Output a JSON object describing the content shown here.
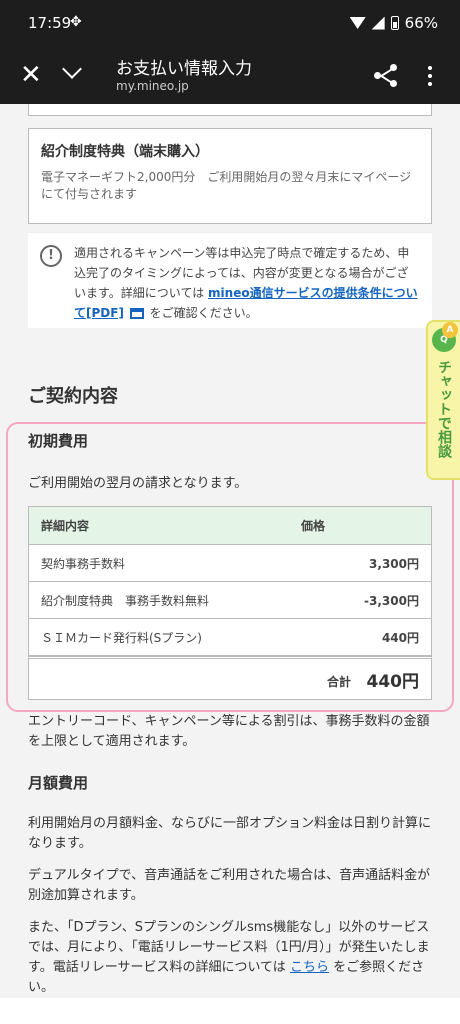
{
  "status_bar": {
    "time": "17:59",
    "fan_glyph": "✥",
    "battery": "66%"
  },
  "app_bar": {
    "title": "お支払い情報入力",
    "url": "my.mineo.jp"
  },
  "benefit": {
    "heading": "紹介制度特典（端末購入）",
    "body": "電子マネーギフト2,000円分　ご利用開始月の翌々月末にマイページにて付与されます"
  },
  "notice": {
    "text_pre": "適用されるキャンペーン等は申込完了時点で確定するため、申込完了のタイミングによっては、内容が変更となる場合がございます。詳細については",
    "link": "mineo通信サービスの提供条件について[PDF]",
    "text_post": "をご確認ください。"
  },
  "contract": {
    "title": "ご契約内容",
    "initial_title": "初期費用",
    "initial_text": "ご利用開始の翌月の請求となります。",
    "table_headers": [
      "詳細内容",
      "価格"
    ],
    "rows": [
      {
        "item": "契約事務手数料",
        "price": "3,300円"
      },
      {
        "item": "紹介制度特典　事務手数料無料",
        "price": "-3,300円"
      },
      {
        "item": "ＳＩＭカード発行料(Sプラン)",
        "price": "440円"
      }
    ],
    "total_label": "合計",
    "total_value": "440円",
    "discount_note": "エントリーコード、キャンペーン等による割引は、事務手数料の金額を上限として適用されます。"
  },
  "monthly": {
    "title": "月額費用",
    "p1": "利用開始月の月額料金、ならびに一部オプション料金は日割り計算になります。",
    "p2": "デュアルタイプで、音声通話をご利用された場合は、音声通話料金が別途加算されます。",
    "p3_pre": "また、「Dプラン、Sプランのシングルsms機能なし」以外のサービスでは、月により、「電話リレーサービス料（1円/月）」が発生いたします。電話リレーサービス料の詳細については",
    "p3_link": "こちら",
    "p3_post": "をご参照ください。"
  },
  "chat": {
    "badge_q": "Q",
    "badge_a": "A",
    "label": "チャットで相談"
  },
  "colors": {
    "app_bar": "#1d1d1d",
    "link": "#1565c0",
    "table_head": "#e4f5e7",
    "highlight": "#f4a6c3",
    "chat_bg": "#f8f5a8"
  }
}
